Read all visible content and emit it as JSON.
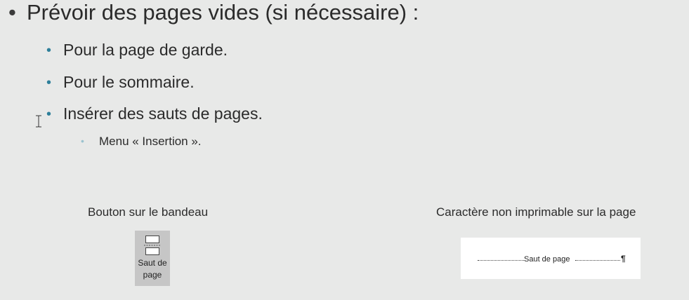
{
  "bullets": {
    "level1": {
      "bullet": "•",
      "text": "Prévoir des pages vides (si nécessaire) :"
    },
    "level2": [
      {
        "bullet": "•",
        "text": "Pour la page de garde."
      },
      {
        "bullet": "•",
        "text": "Pour le sommaire."
      },
      {
        "bullet": "•",
        "text": "Insérer des sauts de pages."
      }
    ],
    "level3": [
      {
        "bullet": "•",
        "text": "Menu « Insertion »."
      }
    ]
  },
  "captions": {
    "left": "Bouton sur le bandeau",
    "right": "Caractère non imprimable sur la page"
  },
  "ribbon_button": {
    "icon": "page-break-icon",
    "label": "Saut de\npage"
  },
  "page_break_preview": {
    "text": "Saut de page",
    "mark": "¶"
  },
  "colors": {
    "background": "#e8e9e8",
    "level2_bullet": "#2e7f9a",
    "level3_bullet": "#9bc3cf",
    "ribbon_button_bg": "#c6c6c6"
  },
  "cursor": "i-beam-cursor-icon"
}
